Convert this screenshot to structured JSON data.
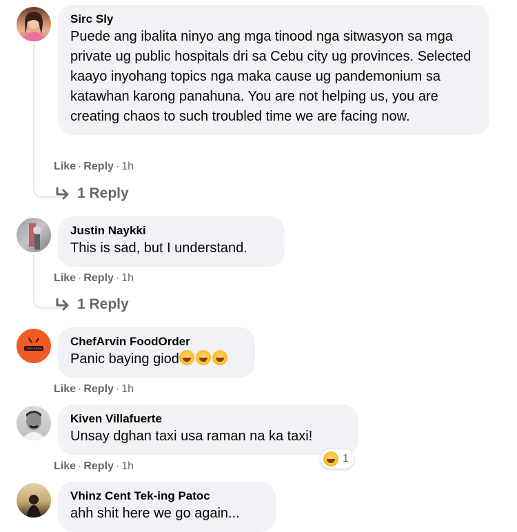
{
  "comments": [
    {
      "author": "Sirc Sly",
      "text": "Puede ang ibalita ninyo ang mga tinood nga sitwasyon sa mga private ug public hospitals dri sa Cebu city ug provinces. Selected kaayo inyohang topics nga maka cause ug pandemonium sa katawhan karong panahuna. You are not helping us, you are creating chaos to such troubled time we are facing now.",
      "like": "Like",
      "reply": "Reply",
      "time": "1h",
      "replies_link": "1 Reply"
    },
    {
      "author": "Justin Naykki",
      "text": "This is sad, but I understand.",
      "like": "Like",
      "reply": "Reply",
      "time": "1h",
      "replies_link": "1 Reply"
    },
    {
      "author": "ChefArvin FoodOrder",
      "text": "Panic baying giod",
      "like": "Like",
      "reply": "Reply",
      "time": "1h",
      "emoji_count": 3,
      "avatar_label": "CHEF ARVIN"
    },
    {
      "author": "Kiven Villafuerte",
      "text": "Unsay dghan taxi usa raman na ka taxi!",
      "like": "Like",
      "reply": "Reply",
      "time": "1h",
      "reaction_count": "1"
    },
    {
      "author": "Vhinz Cent Tek-ing Patoc",
      "text": "ahh shit here we go again..."
    }
  ],
  "separator": "·",
  "colors": {
    "bubble": "#f0f2f5",
    "meta": "#65676b",
    "text": "#050505",
    "chef_avatar": "#f15a24"
  }
}
